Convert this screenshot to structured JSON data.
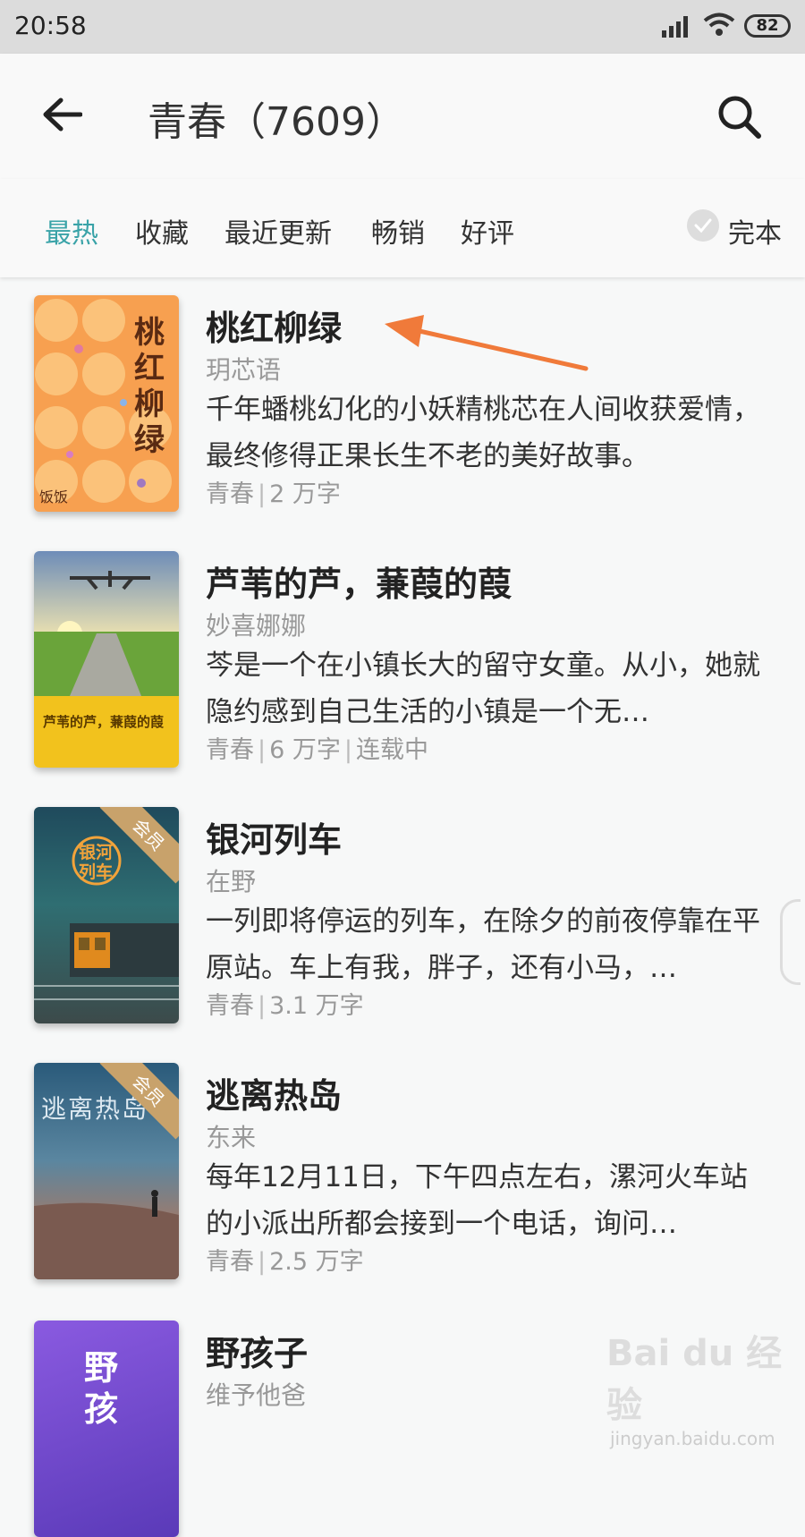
{
  "status_bar": {
    "time": "20:58",
    "battery": "82",
    "icons": [
      "signal-icon",
      "wifi-icon",
      "battery-icon"
    ]
  },
  "header": {
    "title": "青春（7609）",
    "icons": [
      "back-arrow-icon",
      "search-icon"
    ]
  },
  "sort_tabs": [
    {
      "label": "最热",
      "active": true
    },
    {
      "label": "收藏",
      "active": false
    },
    {
      "label": "最近更新",
      "active": false
    },
    {
      "label": "畅销",
      "active": false
    },
    {
      "label": "好评",
      "active": false
    }
  ],
  "filter": {
    "label": "完本",
    "checked": false
  },
  "books": [
    {
      "title": "桃红柳绿",
      "author": "玥芯语",
      "description": "千年蟠桃幻化的小妖精桃芯在人间收获爱情，最终修得正果长生不老的美好故事。",
      "category": "青春",
      "word_count": "2 万字",
      "status": "",
      "cover_title": "桃红柳绿",
      "cover_publisher": "饭饭",
      "vip_badge": ""
    },
    {
      "title": "芦苇的芦，蒹葭的葭",
      "author": "妙喜娜娜",
      "description": "芩是一个在小镇长大的留守女童。从小，她就隐约感到自己生活的小镇是一个无…",
      "category": "青春",
      "word_count": "6 万字",
      "status": "连载中",
      "cover_title": "芦苇的芦，蒹葭的葭",
      "cover_publisher": "",
      "vip_badge": ""
    },
    {
      "title": "银河列车",
      "author": "在野",
      "description": "一列即将停运的列车，在除夕的前夜停靠在平原站。车上有我，胖子，还有小马，…",
      "category": "青春",
      "word_count": "3.1 万字",
      "status": "",
      "cover_title": "银河列车",
      "cover_publisher": "",
      "vip_badge": "会员"
    },
    {
      "title": "逃离热岛",
      "author": "东来",
      "description": "每年12月11日，下午四点左右，漯河火车站的小派出所都会接到一个电话，询问…",
      "category": "青春",
      "word_count": "2.5 万字",
      "status": "",
      "cover_title": "逃离热岛",
      "cover_publisher": "",
      "vip_badge": "会员"
    },
    {
      "title": "野孩子",
      "author": "维予他爸",
      "description": "",
      "category": "",
      "word_count": "",
      "status": "",
      "cover_title": "野孩",
      "cover_publisher": "",
      "vip_badge": ""
    }
  ],
  "watermark": {
    "brand": "Bai du 经验",
    "url": "jingyan.baidu.com"
  },
  "colors": {
    "accent": "#3aa3a8",
    "annotation_arrow": "#f07a3a"
  }
}
